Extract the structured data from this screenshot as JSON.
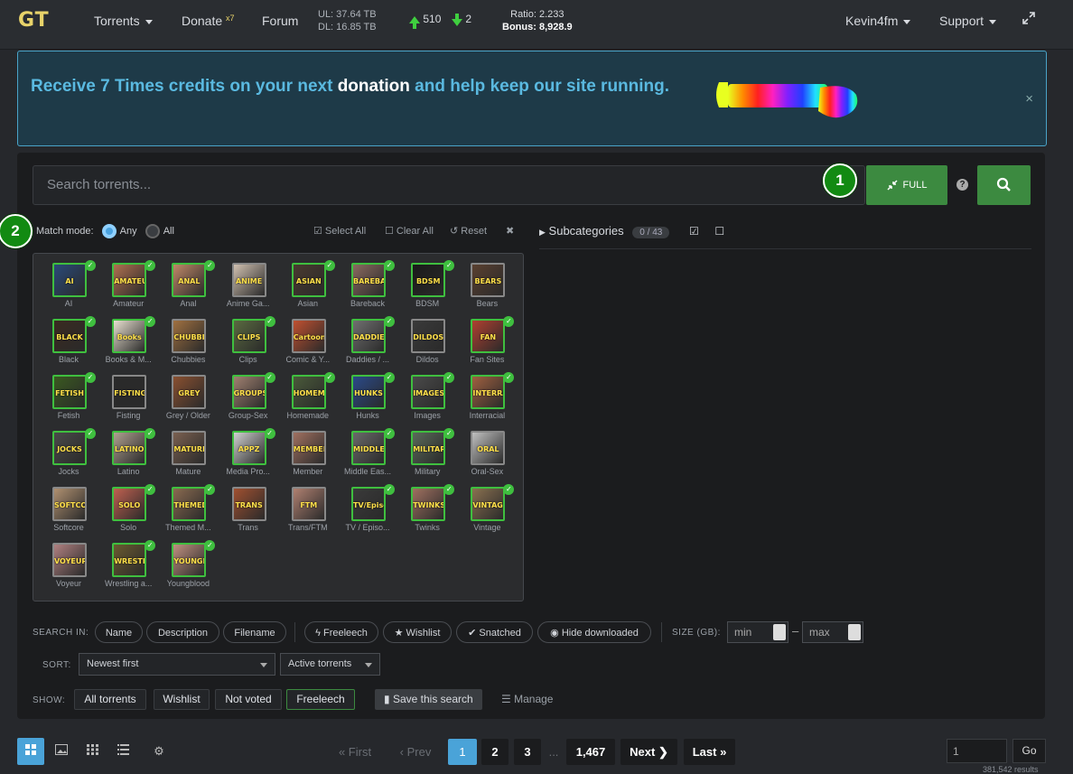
{
  "header": {
    "logo": "GT",
    "nav": [
      {
        "label": "Torrents"
      },
      {
        "label": "Donate"
      },
      {
        "label": "Forum"
      }
    ],
    "donate_multiplier": "x7",
    "ul": "UL: 37.64 TB",
    "dl": "DL: 16.85 TB",
    "seeding": "510",
    "leeching": "2",
    "ratio": "Ratio: 2.233",
    "bonus_label": "Bonus:",
    "bonus_value": "8,928.9",
    "user": "Kevin4fm",
    "support": "Support"
  },
  "banner": {
    "text_1": "Receive 7 Times credits on your next ",
    "text_hl": "donation",
    "text_2": " and help keep our site running.",
    "close": "×"
  },
  "search": {
    "placeholder": "Search torrents...",
    "full_label": "FULL",
    "help": "?",
    "badge_1": "1",
    "badge_2": "2"
  },
  "match": {
    "label": "Match mode:",
    "any": "Any",
    "all": "All",
    "select_all": "Select All",
    "clear_all": "Clear All",
    "reset": "Reset",
    "close": "✖"
  },
  "subcategories": {
    "label": "Subcategories",
    "count": "0 / 43"
  },
  "categories": [
    {
      "label": "AI",
      "thumb": "AI VIDEOS",
      "selected": true,
      "color": "#2a4a7a"
    },
    {
      "label": "Amateur",
      "thumb": "AMATEUR",
      "selected": true,
      "color": "#b07050"
    },
    {
      "label": "Anal",
      "thumb": "ANAL",
      "selected": true,
      "color": "#c08868"
    },
    {
      "label": "Anime Ga...",
      "thumb": "ANIME GAMES",
      "selected": false,
      "color": "#d0c0b0"
    },
    {
      "label": "Asian",
      "thumb": "ASIAN",
      "selected": true,
      "color": "#4a3a30"
    },
    {
      "label": "Bareback",
      "thumb": "BAREBACK",
      "selected": true,
      "color": "#8a6a60"
    },
    {
      "label": "BDSM",
      "thumb": "BDSM",
      "selected": true,
      "color": "#1a1a1a"
    },
    {
      "label": "Bears",
      "thumb": "BEARS",
      "selected": false,
      "color": "#5a4030"
    },
    {
      "label": "Black",
      "thumb": "BLACK",
      "selected": true,
      "color": "#3a2a20"
    },
    {
      "label": "Books & M...",
      "thumb": "Books & Magazines",
      "selected": true,
      "color": "#e8e0d0"
    },
    {
      "label": "Chubbies",
      "thumb": "CHUBBIES",
      "selected": false,
      "color": "#a07040"
    },
    {
      "label": "Clips",
      "thumb": "CLIPS",
      "selected": true,
      "color": "#5a6a40"
    },
    {
      "label": "Comic & Y...",
      "thumb": "Cartoons Comics Yaoi",
      "selected": false,
      "color": "#c05030"
    },
    {
      "label": "Daddies / ...",
      "thumb": "DADDIES",
      "selected": true,
      "color": "#707070"
    },
    {
      "label": "Dildos",
      "thumb": "DILDOS",
      "selected": false,
      "color": "#3a3a3a"
    },
    {
      "label": "Fan Sites",
      "thumb": "FAN SITES",
      "selected": true,
      "color": "#b04030"
    },
    {
      "label": "Fetish",
      "thumb": "FETISH",
      "selected": true,
      "color": "#3a5a20"
    },
    {
      "label": "Fisting",
      "thumb": "FISTING",
      "selected": false,
      "color": "#2a2a2a"
    },
    {
      "label": "Grey / Older",
      "thumb": "GREY OLDER",
      "selected": false,
      "color": "#8a5030"
    },
    {
      "label": "Group-Sex",
      "thumb": "GROUPSEX",
      "selected": true,
      "color": "#a08070"
    },
    {
      "label": "Homemade",
      "thumb": "HOMEMADE",
      "selected": true,
      "color": "#4a5a3a"
    },
    {
      "label": "Hunks",
      "thumb": "HUNKS",
      "selected": true,
      "color": "#2a4a8a"
    },
    {
      "label": "Images",
      "thumb": "IMAGES",
      "selected": true,
      "color": "#4a4a4a"
    },
    {
      "label": "Interracial",
      "thumb": "INTERRACIAL",
      "selected": true,
      "color": "#a06040"
    },
    {
      "label": "Jocks",
      "thumb": "JOCKS",
      "selected": true,
      "color": "#4a4a4a"
    },
    {
      "label": "Latino",
      "thumb": "LATINO",
      "selected": true,
      "color": "#b0a090"
    },
    {
      "label": "Mature",
      "thumb": "MATURE",
      "selected": false,
      "color": "#7a6050"
    },
    {
      "label": "Media Pro...",
      "thumb": "APPZ",
      "selected": true,
      "color": "#d0d0d0"
    },
    {
      "label": "Member",
      "thumb": "MEMBERS",
      "selected": false,
      "color": "#a07060"
    },
    {
      "label": "Middle Eas...",
      "thumb": "MIDDLE EASTERN",
      "selected": true,
      "color": "#6a6a6a"
    },
    {
      "label": "Military",
      "thumb": "MILITARY",
      "selected": true,
      "color": "#5a6a5a"
    },
    {
      "label": "Oral-Sex",
      "thumb": "ORAL SEX",
      "selected": false,
      "color": "#c0c0c0"
    },
    {
      "label": "Softcore",
      "thumb": "SOFTCORE",
      "selected": false,
      "color": "#b09070"
    },
    {
      "label": "Solo",
      "thumb": "SOLO",
      "selected": true,
      "color": "#c06050"
    },
    {
      "label": "Themed M...",
      "thumb": "THEMED MOVIE",
      "selected": true,
      "color": "#8a6a50"
    },
    {
      "label": "Trans",
      "thumb": "TRANS",
      "selected": false,
      "color": "#a05030"
    },
    {
      "label": "Trans/FTM",
      "thumb": "FTM",
      "selected": false,
      "color": "#b08070"
    },
    {
      "label": "TV / Episo...",
      "thumb": "TV/Episodes",
      "selected": true,
      "color": "#3a3a3a"
    },
    {
      "label": "Twinks",
      "thumb": "TWINKS",
      "selected": true,
      "color": "#a07060"
    },
    {
      "label": "Vintage",
      "thumb": "VINTAGE",
      "selected": true,
      "color": "#8a7050"
    },
    {
      "label": "Voyeur",
      "thumb": "VOYEUR",
      "selected": false,
      "color": "#b08080"
    },
    {
      "label": "Wrestling a...",
      "thumb": "WRESTLING SPORTS",
      "selected": true,
      "color": "#6a5a30"
    },
    {
      "label": "Youngblood",
      "thumb": "YOUNGBLOOD",
      "selected": true,
      "color": "#c09080"
    }
  ],
  "options": {
    "search_in_label": "SEARCH IN:",
    "name": "Name",
    "description": "Description",
    "filename": "Filename",
    "freeleech": "Freeleech",
    "wishlist": "Wishlist",
    "snatched": "Snatched",
    "hide_downloaded": "Hide downloaded",
    "size_label": "SIZE (GB):",
    "min_placeholder": "min",
    "max_placeholder": "max",
    "dash": "–",
    "sort_label": "SORT:",
    "sort_value": "Newest first",
    "filter_value": "Active torrents",
    "show_label": "SHOW:",
    "all_torrents": "All torrents",
    "show_wishlist": "Wishlist",
    "not_voted": "Not voted",
    "show_freeleech": "Freeleech",
    "save_search": "Save this search",
    "manage": "Manage"
  },
  "pagination": {
    "first": "« First",
    "prev": "‹ Prev",
    "pages": [
      "1",
      "2",
      "3"
    ],
    "ellipsis": "...",
    "last_page": "1,467",
    "next": "Next",
    "last": "Last",
    "page_input": "1",
    "go": "Go",
    "results": "381,542 results"
  },
  "colors": {
    "accent_green": "#3c8a40",
    "accent_blue": "#4aa3d8",
    "banner_text": "#5ab9e0"
  }
}
